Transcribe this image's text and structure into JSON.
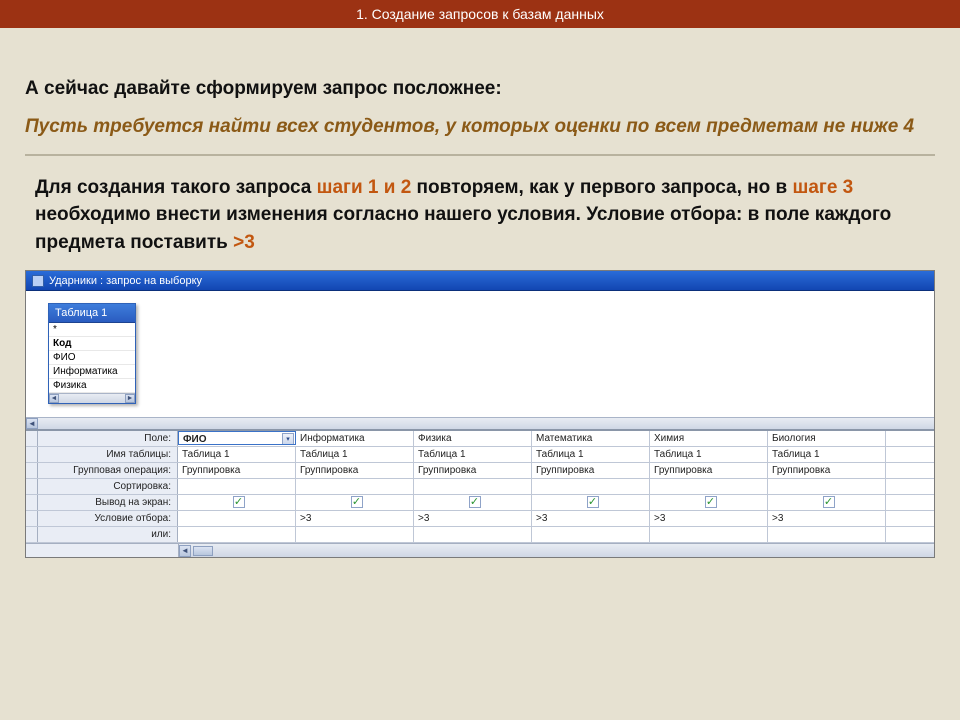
{
  "header": {
    "title": "1. Создание запросов к базам данных"
  },
  "heading": "А сейчас давайте сформируем запрос посложнее:",
  "task": "Пусть требуется найти всех студентов, у которых оценки по всем предметам не ниже 4",
  "body": {
    "pre1": "Для создания такого запроса ",
    "steps12": "шаги 1 и 2",
    "mid1": " повторяем, как у первого запроса, но в ",
    "step3": "шаге 3",
    "mid2": " необходимо внести изменения согласно нашего условия. Условие отбора: в поле каждого предмета поставить ",
    "gt3": ">3"
  },
  "window": {
    "title": "Ударники : запрос на выборку"
  },
  "table_widget": {
    "title": "Таблица 1",
    "items": [
      "*",
      "Код",
      "ФИО",
      "Информатика",
      "Физика"
    ]
  },
  "grid": {
    "row_labels": [
      "Поле:",
      "Имя таблицы:",
      "Групповая операция:",
      "Сортировка:",
      "Вывод на экран:",
      "Условие отбора:",
      "или:"
    ],
    "columns": [
      {
        "field": "ФИО",
        "table": "Таблица 1",
        "group": "Группировка",
        "sort": "",
        "show": true,
        "criteria": ""
      },
      {
        "field": "Информатика",
        "table": "Таблица 1",
        "group": "Группировка",
        "sort": "",
        "show": true,
        "criteria": ">3"
      },
      {
        "field": "Физика",
        "table": "Таблица 1",
        "group": "Группировка",
        "sort": "",
        "show": true,
        "criteria": ">3"
      },
      {
        "field": "Математика",
        "table": "Таблица 1",
        "group": "Группировка",
        "sort": "",
        "show": true,
        "criteria": ">3"
      },
      {
        "field": "Химия",
        "table": "Таблица 1",
        "group": "Группировка",
        "sort": "",
        "show": true,
        "criteria": ">3"
      },
      {
        "field": "Биология",
        "table": "Таблица 1",
        "group": "Группировка",
        "sort": "",
        "show": true,
        "criteria": ">3"
      }
    ]
  }
}
